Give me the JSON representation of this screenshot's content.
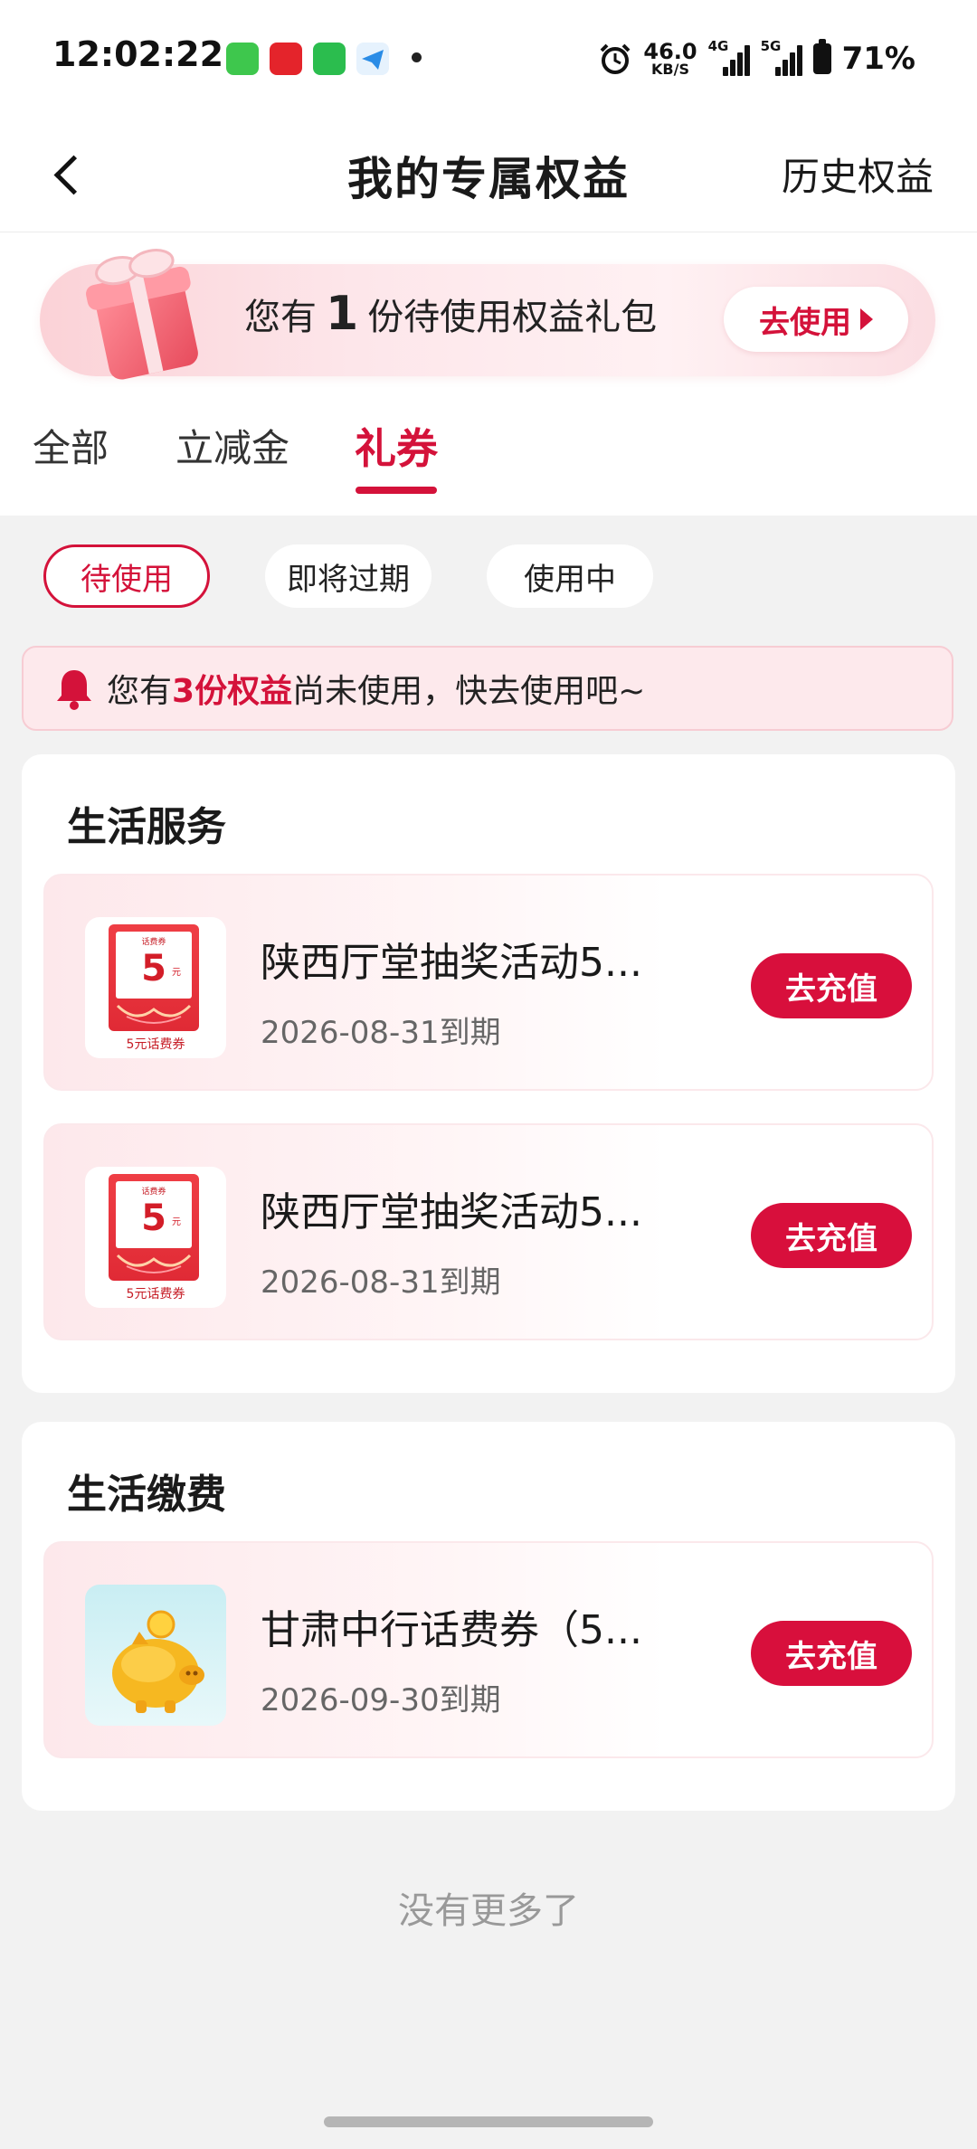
{
  "status_bar": {
    "time": "12:02:22",
    "net_speed": "46.0",
    "net_unit": "KB/S",
    "net_4g": "4G",
    "net_5g": "5G",
    "battery": "71%"
  },
  "header": {
    "title": "我的专属权益",
    "history": "历史权益"
  },
  "banner": {
    "prefix": "您有",
    "count": "1",
    "suffix": "份待使用权益礼包",
    "button": "去使用"
  },
  "tabs": [
    "全部",
    "立减金",
    "礼券"
  ],
  "active_tab": "礼券",
  "filters": [
    "待使用",
    "即将过期",
    "使用中"
  ],
  "notice": {
    "prefix": "您有",
    "highlight": "3份权益",
    "suffix": "尚未使用，快去使用吧~"
  },
  "sections": [
    {
      "title": "生活服务",
      "items": [
        {
          "title": "陕西厅堂抽奖活动5...",
          "date": "2026-08-31到期",
          "button": "去充值",
          "thumb_top": "话费券",
          "thumb_value": "5",
          "thumb_unit": "元",
          "thumb_label": "5元话费券"
        },
        {
          "title": "陕西厅堂抽奖活动5...",
          "date": "2026-08-31到期",
          "button": "去充值",
          "thumb_top": "话费券",
          "thumb_value": "5",
          "thumb_unit": "元",
          "thumb_label": "5元话费券"
        }
      ]
    },
    {
      "title": "生活缴费",
      "items": [
        {
          "title": "甘肃中行话费券（5...",
          "date": "2026-09-30到期",
          "button": "去充值"
        }
      ]
    }
  ],
  "footer": {
    "end_text": "没有更多了"
  },
  "colors": {
    "accent": "#d4123a",
    "button": "#d80f3c"
  }
}
